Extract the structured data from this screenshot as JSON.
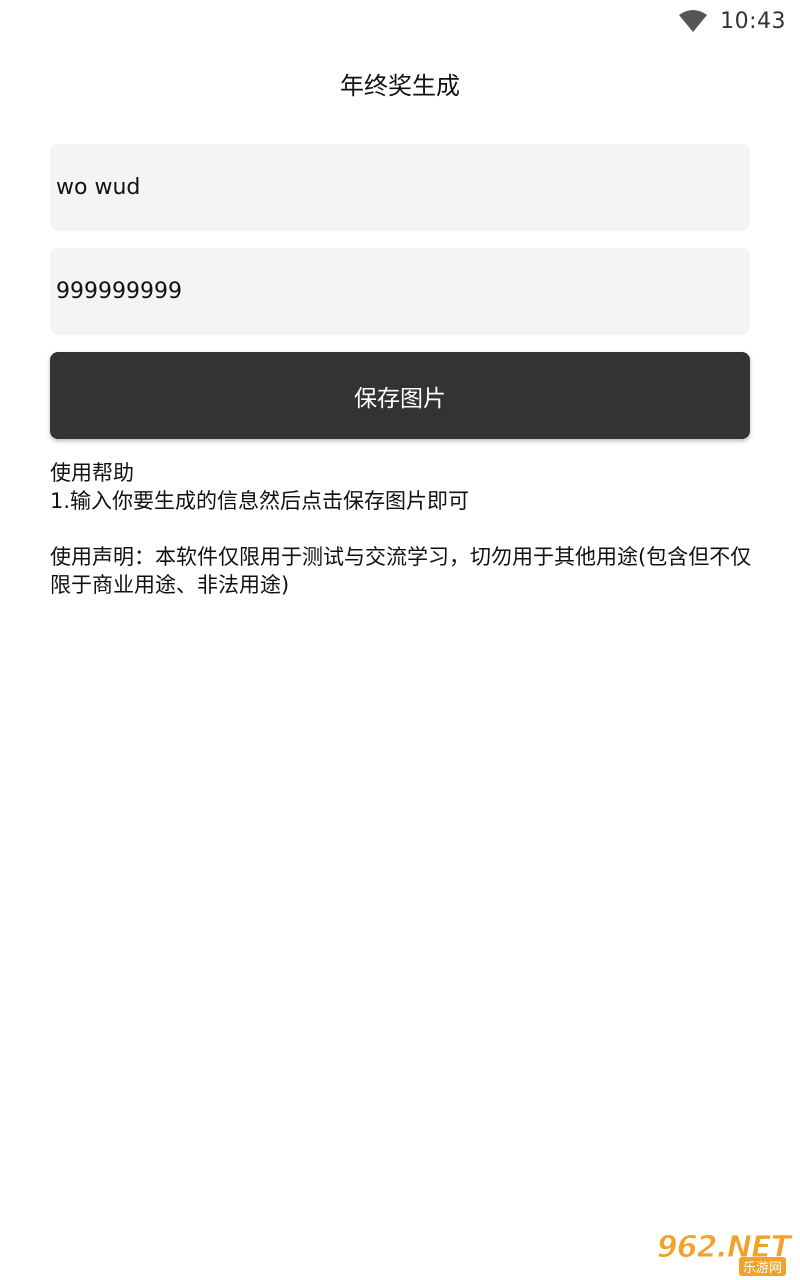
{
  "status_bar": {
    "time": "10:43",
    "icons": [
      "wifi-icon"
    ]
  },
  "header": {
    "title": "年终奖生成"
  },
  "form": {
    "name_value": "wo wud",
    "amount_value": "999999999",
    "save_label": "保存图片"
  },
  "help": {
    "heading": "使用帮助",
    "step1": "1.输入你要生成的信息然后点击保存图片即可",
    "disclaimer": "使用声明：本软件仅限用于测试与交流学习，切勿用于其他用途(包含但不仅限于商业用途、非法用途)"
  },
  "watermark": {
    "brand": "962.NET",
    "sub": "乐游网"
  },
  "colors": {
    "button_bg": "#333333",
    "field_bg": "#f4f4f4",
    "watermark_accent": "#f2a12b"
  }
}
